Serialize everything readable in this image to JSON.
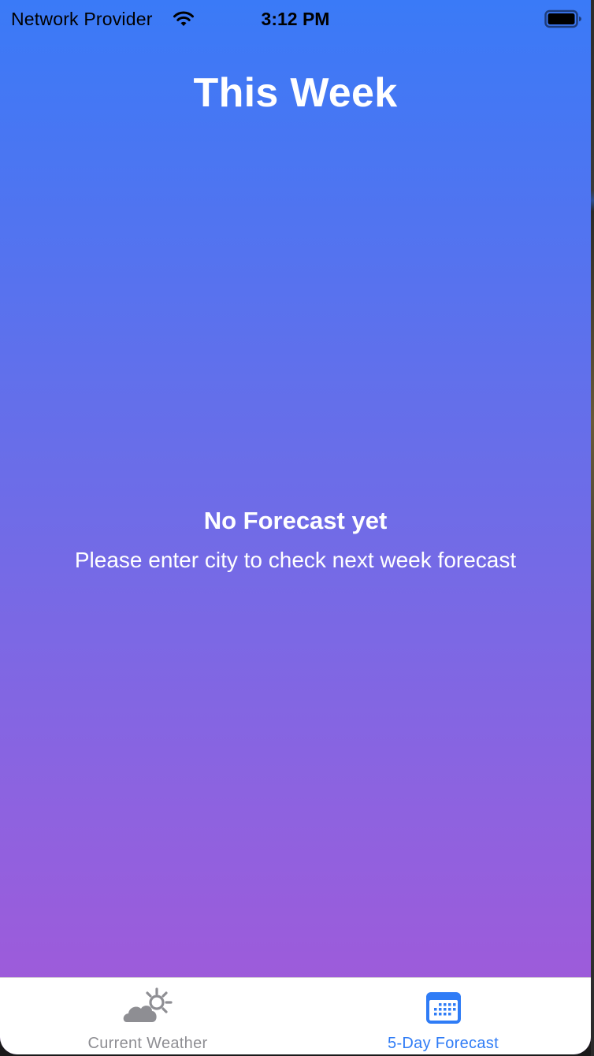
{
  "status_bar": {
    "carrier": "Network Provider",
    "time": "3:12 PM",
    "wifi_icon": "wifi-icon",
    "battery_icon": "battery-icon"
  },
  "screen": {
    "title": "This Week"
  },
  "empty_state": {
    "title": "No Forecast yet",
    "message": "Please enter city to check next week forecast"
  },
  "tab_bar": {
    "tabs": [
      {
        "label": "Current Weather",
        "icon": "cloud-sun-icon",
        "selected": false,
        "color": "#8e8e93"
      },
      {
        "label": "5-Day Forecast",
        "icon": "calendar-icon",
        "selected": true,
        "color": "#2f7cf6"
      }
    ]
  },
  "colors": {
    "gradient_top": "#3a7af7",
    "gradient_bottom": "#a458d8",
    "accent": "#2f7cf6",
    "inactive": "#8e8e93"
  }
}
